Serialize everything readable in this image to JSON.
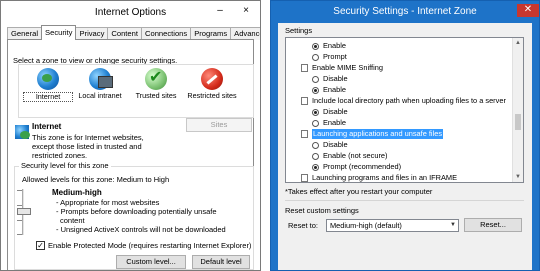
{
  "left": {
    "title": "Internet Options",
    "minimize_glyph": "–",
    "close_glyph": "×",
    "tabs": [
      "General",
      "Security",
      "Privacy",
      "Content",
      "Connections",
      "Programs",
      "Advanced"
    ],
    "active_tab": "Security",
    "zone_prompt": "Select a zone to view or change security settings.",
    "zones": [
      {
        "label": "Internet",
        "icon": "globe-icon"
      },
      {
        "label": "Local intranet",
        "icon": "intranet-icon"
      },
      {
        "label": "Trusted sites",
        "icon": "trusted-sites-icon"
      },
      {
        "label": "Restricted sites",
        "icon": "restricted-sites-icon"
      }
    ],
    "selected_zone": {
      "name": "Internet",
      "description_lines": [
        "This zone is for Internet websites,",
        "except those listed in trusted and",
        "restricted zones."
      ]
    },
    "sites_button": "Sites",
    "security_level": {
      "group_title": "Security level for this zone",
      "allowed_levels": "Allowed levels for this zone: Medium to High",
      "level_name": "Medium-high",
      "bullets": [
        "- Appropriate for most websites",
        "- Prompts before downloading potentially unsafe",
        "content",
        "- Unsigned ActiveX controls will not be downloaded"
      ]
    },
    "protected_mode": {
      "label": "Enable Protected Mode (requires restarting Internet Explorer)",
      "checked": true
    },
    "custom_level_button": "Custom level...",
    "default_level_button": "Default level"
  },
  "right": {
    "title": "Security Settings - Internet Zone",
    "close_glyph": "✕",
    "settings_label": "Settings",
    "rows": [
      {
        "type": "radio",
        "label": "Enable",
        "checked": true,
        "indent": 1
      },
      {
        "type": "radio",
        "label": "Prompt",
        "checked": false,
        "indent": 1
      },
      {
        "type": "header",
        "label": "Enable MIME Sniffing"
      },
      {
        "type": "radio",
        "label": "Disable",
        "checked": false,
        "indent": 1
      },
      {
        "type": "radio",
        "label": "Enable",
        "checked": true,
        "indent": 1
      },
      {
        "type": "header",
        "label": "Include local directory path when uploading files to a server"
      },
      {
        "type": "radio",
        "label": "Disable",
        "checked": true,
        "indent": 1
      },
      {
        "type": "radio",
        "label": "Enable",
        "checked": false,
        "indent": 1
      },
      {
        "type": "header",
        "label": "Launching applications and unsafe files",
        "highlighted": true
      },
      {
        "type": "radio",
        "label": "Disable",
        "checked": false,
        "indent": 1
      },
      {
        "type": "radio",
        "label": "Enable (not secure)",
        "checked": false,
        "indent": 1
      },
      {
        "type": "radio",
        "label": "Prompt (recommended)",
        "checked": true,
        "indent": 1
      },
      {
        "type": "header",
        "label": "Launching programs and files in an IFRAME"
      },
      {
        "type": "radio",
        "label": "Disable",
        "checked": false,
        "indent": 1
      },
      {
        "type": "radio",
        "label": "Enable (not secure)",
        "checked": false,
        "indent": 1
      },
      {
        "type": "radio",
        "label": "Prompt (recommended)",
        "checked": true,
        "indent": 1
      }
    ],
    "footnote": "*Takes effect after you restart your computer",
    "reset_group_label": "Reset custom settings",
    "reset_to_label": "Reset to:",
    "reset_select_value": "Medium-high (default)",
    "reset_button": "Reset..."
  }
}
